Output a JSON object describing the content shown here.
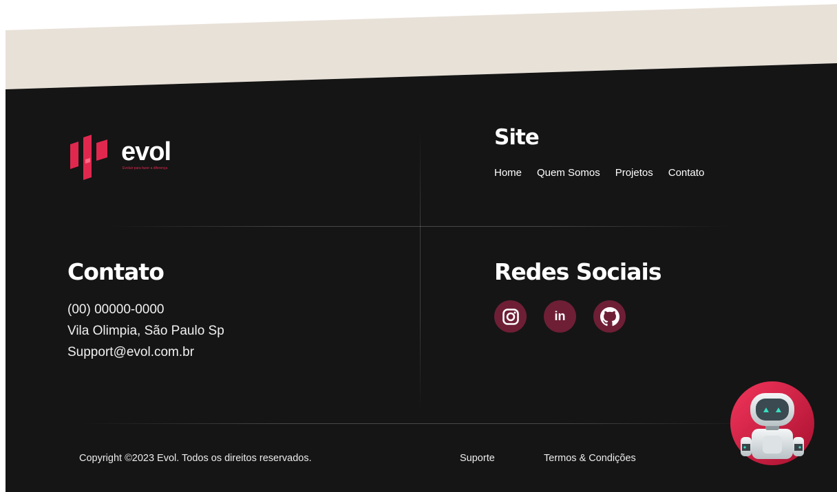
{
  "brand": {
    "name": "evol",
    "tagline": "Evoluir para fazer a diferença",
    "accent_color": "#e0284f",
    "background_color": "#151515",
    "banner_color": "#e8e1d8"
  },
  "site": {
    "title": "Site",
    "links": [
      "Home",
      "Quem Somos",
      "Projetos",
      "Contato"
    ]
  },
  "contact": {
    "title": "Contato",
    "phone": "(00) 00000-0000",
    "address": "Vila Olimpia, São Paulo Sp",
    "email": "Support@evol.com.br"
  },
  "social": {
    "title": "Redes Sociais",
    "items": [
      {
        "icon": "instagram-icon"
      },
      {
        "icon": "linkedin-icon",
        "label": "in"
      },
      {
        "icon": "github-icon"
      }
    ],
    "button_color": "#6e1f36"
  },
  "footer": {
    "copyright": "Copyright ©2023 Evol. Todos os direitos reservados.",
    "support": "Suporte",
    "terms": "Termos & Condições"
  },
  "assistant": {
    "icon": "robot-chat-icon"
  }
}
